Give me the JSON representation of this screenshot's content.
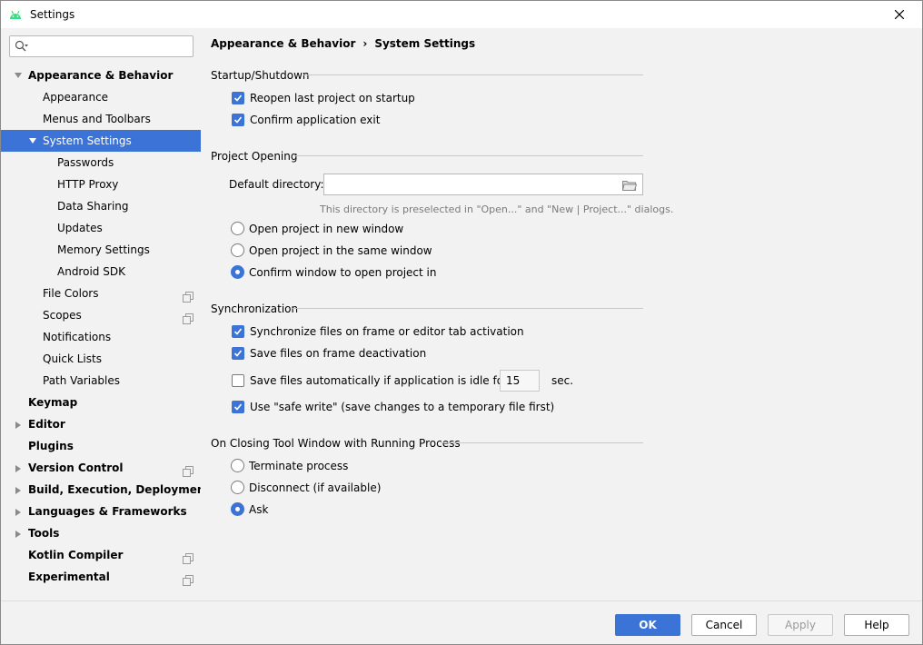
{
  "window": {
    "title": "Settings"
  },
  "search": {
    "placeholder": "",
    "value": ""
  },
  "sidebar": {
    "items": [
      {
        "label": "Appearance & Behavior"
      },
      {
        "label": "Appearance"
      },
      {
        "label": "Menus and Toolbars"
      },
      {
        "label": "System Settings"
      },
      {
        "label": "Passwords"
      },
      {
        "label": "HTTP Proxy"
      },
      {
        "label": "Data Sharing"
      },
      {
        "label": "Updates"
      },
      {
        "label": "Memory Settings"
      },
      {
        "label": "Android SDK"
      },
      {
        "label": "File Colors"
      },
      {
        "label": "Scopes"
      },
      {
        "label": "Notifications"
      },
      {
        "label": "Quick Lists"
      },
      {
        "label": "Path Variables"
      },
      {
        "label": "Keymap"
      },
      {
        "label": "Editor"
      },
      {
        "label": "Plugins"
      },
      {
        "label": "Version Control"
      },
      {
        "label": "Build, Execution, Deployment"
      },
      {
        "label": "Languages & Frameworks"
      },
      {
        "label": "Tools"
      },
      {
        "label": "Kotlin Compiler"
      },
      {
        "label": "Experimental"
      }
    ],
    "selected": "System Settings"
  },
  "breadcrumb": {
    "parent": "Appearance & Behavior",
    "separator": "›",
    "current": "System Settings"
  },
  "startup": {
    "title": "Startup/Shutdown",
    "reopen_label": "Reopen last project on startup",
    "reopen_checked": true,
    "confirm_exit_label": "Confirm application exit",
    "confirm_exit_checked": true
  },
  "project_opening": {
    "title": "Project Opening",
    "default_dir_label": "Default directory:",
    "default_dir_value": "",
    "hint": "This directory is preselected in \"Open...\" and \"New | Project...\" dialogs.",
    "options": [
      "Open project in new window",
      "Open project in the same window",
      "Confirm window to open project in"
    ],
    "selected": "Confirm window to open project in"
  },
  "sync": {
    "title": "Synchronization",
    "frame_activation_label": "Synchronize files on frame or editor tab activation",
    "frame_activation_checked": true,
    "frame_deactivation_label": "Save files on frame deactivation",
    "frame_deactivation_checked": true,
    "idle_label": "Save files automatically if application is idle for",
    "idle_checked": false,
    "idle_value": "15",
    "idle_unit": "sec.",
    "safe_write_label": "Use \"safe write\" (save changes to a temporary file first)",
    "safe_write_checked": true
  },
  "closing": {
    "title": "On Closing Tool Window with Running Process",
    "options": [
      "Terminate process",
      "Disconnect (if available)",
      "Ask"
    ],
    "selected": "Ask"
  },
  "footer": {
    "ok": "OK",
    "cancel": "Cancel",
    "apply": "Apply",
    "help": "Help"
  },
  "colors": {
    "accent": "#3b73d6",
    "background": "#f2f2f2"
  },
  "icons": {
    "app": "android-icon",
    "close": "close-icon",
    "search": "search-icon",
    "folder": "folder-icon",
    "copy": "project-level-icon",
    "expand": "triangle-icon"
  }
}
